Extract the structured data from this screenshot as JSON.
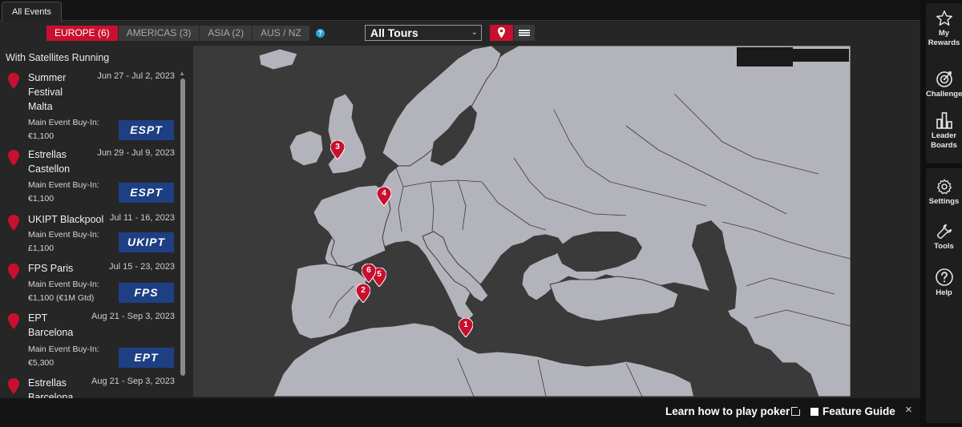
{
  "tabs": {
    "all_events": "All Events"
  },
  "regions": [
    {
      "label": "EUROPE (6)",
      "active": true
    },
    {
      "label": "AMERICAS (3)",
      "active": false
    },
    {
      "label": "ASIA (2)",
      "active": false
    },
    {
      "label": "AUS / NZ",
      "active": false
    }
  ],
  "help_icon": "?",
  "tours_filter": {
    "selected": "All Tours"
  },
  "events_panel": {
    "heading": "With Satellites Running",
    "buyin_label": "Main Event Buy-In:",
    "events": [
      {
        "name": "Summer Festival Malta",
        "dates": "Jun 27 - Jul 2, 2023",
        "buyin": "€1,100",
        "logo": "ESPT"
      },
      {
        "name": "Estrellas Castellon",
        "dates": "Jun 29 - Jul 9, 2023",
        "buyin": "€1,100",
        "logo": "ESPT"
      },
      {
        "name": "UKIPT Blackpool",
        "dates": "Jul 11 - 16, 2023",
        "buyin": "£1,100",
        "logo": "UKIPT"
      },
      {
        "name": "FPS Paris",
        "dates": "Jul 15 - 23, 2023",
        "buyin": "€1,100 (€1M Gtd)",
        "logo": "FPS"
      },
      {
        "name": "EPT Barcelona",
        "dates": "Aug 21 - Sep 3, 2023",
        "buyin": "€5,300",
        "logo": "EPT"
      },
      {
        "name": "Estrellas Barcelona",
        "dates": "Aug 21 - Sep 3, 2023",
        "buyin": "",
        "logo": ""
      }
    ]
  },
  "map_pins": [
    "1",
    "2",
    "3",
    "4",
    "5",
    "6"
  ],
  "bottom_bar": {
    "learn": "Learn how to play poker",
    "feature_guide": "Feature Guide",
    "close": "×"
  },
  "sidebar": [
    {
      "label1": "My",
      "label2": "Rewards",
      "icon": "star-icon"
    },
    {
      "label1": "Challenge",
      "label2": "",
      "icon": "target-icon"
    },
    {
      "label1": "Leader",
      "label2": "Boards",
      "icon": "leaderboard-icon"
    },
    {
      "label1": "Settings",
      "label2": "",
      "icon": "gear-icon"
    },
    {
      "label1": "Tools",
      "label2": "",
      "icon": "wrench-icon"
    },
    {
      "label1": "Help",
      "label2": "",
      "icon": "help-icon"
    }
  ],
  "colors": {
    "accent": "#c8102e",
    "logo_bg": "#1e3f84",
    "land": "#b3b3bb",
    "sea": "#3a3a3a"
  }
}
